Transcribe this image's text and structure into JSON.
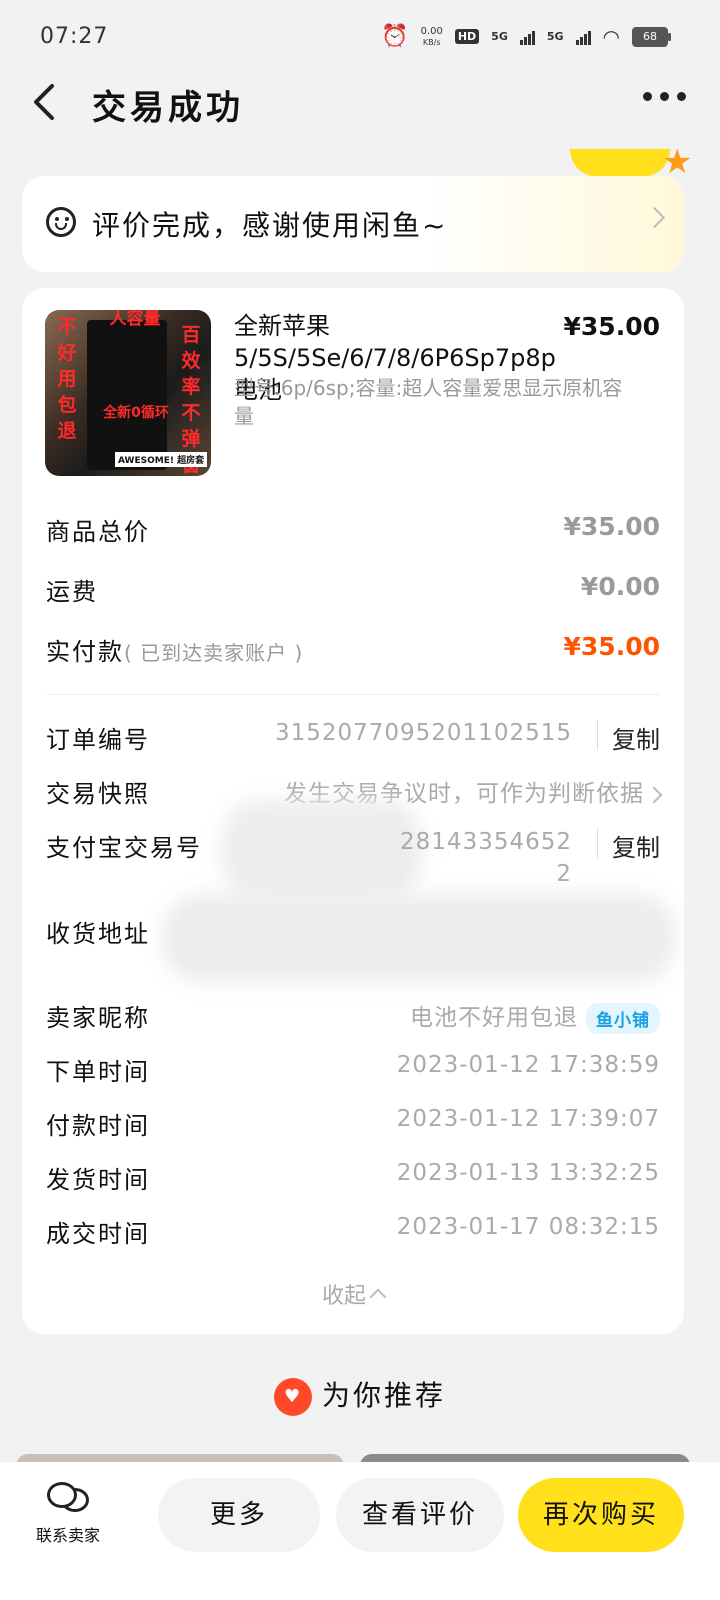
{
  "status_bar": {
    "time": "07:27",
    "net_speed_value": "0.00",
    "net_speed_unit": "KB/s",
    "hd_label": "HD",
    "signal1_label": "5G",
    "signal2_label": "5G",
    "battery": "68"
  },
  "nav": {
    "title": "交易成功"
  },
  "review_banner": {
    "text": "评价完成，感谢使用闲鱼~"
  },
  "product": {
    "title": "全新苹果5/5S/5Se/6/7/8/6P6Sp7p8p电池",
    "spec": "型号:6p/6sp;容量:超人容量爱思显示原机容量",
    "price": "¥35.00",
    "image_texts": {
      "left": "不好用包退",
      "right": "百效率不弹窗",
      "top": "人容量",
      "middle": "全新0循环",
      "badge": "AWESOME! 超房套"
    }
  },
  "summary": {
    "total_label": "商品总价",
    "total_value": "¥35.00",
    "shipping_label": "运费",
    "shipping_value": "¥0.00",
    "paid_label": "实付款",
    "paid_hint": "( 已到达卖家账户 )",
    "paid_value": "¥35.00"
  },
  "details": {
    "order_no_label": "订单编号",
    "order_no_value": "3152077095201102515",
    "copy_label": "复制",
    "snapshot_label": "交易快照",
    "snapshot_value": "发生交易争议时，可作为判断依据",
    "alipay_label": "支付宝交易号",
    "alipay_value_line1": "28143354652",
    "alipay_value_line2": "2",
    "address_label": "收货地址",
    "seller_label": "卖家昵称",
    "seller_value": "电池不好用包退",
    "seller_badge": "鱼小铺",
    "order_time_label": "下单时间",
    "order_time_value": "2023-01-12 17:38:59",
    "pay_time_label": "付款时间",
    "pay_time_value": "2023-01-12 17:39:07",
    "ship_time_label": "发货时间",
    "ship_time_value": "2023-01-13 13:32:25",
    "deal_time_label": "成交时间",
    "deal_time_value": "2023-01-17 08:32:15",
    "collapse_label": "收起"
  },
  "recommend": {
    "title": "为你推荐"
  },
  "bottom_bar": {
    "contact_label": "联系卖家",
    "more_label": "更多",
    "view_review_label": "查看评价",
    "rebuy_label": "再次购买"
  },
  "colors": {
    "accent_yellow": "#ffe01a",
    "price_red": "#ff5300",
    "badge_blue": "#1aa0e0"
  }
}
